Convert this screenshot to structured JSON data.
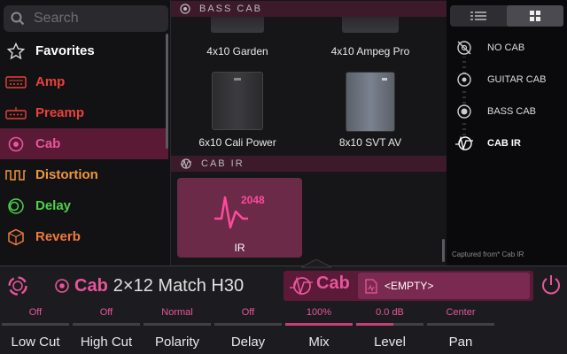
{
  "search": {
    "placeholder": "Search"
  },
  "categories": [
    {
      "label": "Favorites",
      "color": "#ffffff"
    },
    {
      "label": "Amp",
      "color": "#e8433a"
    },
    {
      "label": "Preamp",
      "color": "#e8433a"
    },
    {
      "label": "Cab",
      "color": "#e8559a",
      "selected": true
    },
    {
      "label": "Distortion",
      "color": "#f0963a"
    },
    {
      "label": "Delay",
      "color": "#4fd24a"
    },
    {
      "label": "Reverb",
      "color": "#f07a3a"
    }
  ],
  "browser": {
    "section1": "BASS CAB",
    "items": [
      {
        "label": "4x10 Garden"
      },
      {
        "label": "4x10 Ampeg Pro"
      },
      {
        "label": "6x10 Cali Power"
      },
      {
        "label": "8x10 SVT AV"
      }
    ],
    "section2": "CAB IR",
    "ir": {
      "label": "IR",
      "size": "2048"
    }
  },
  "right_panel": {
    "options": [
      {
        "label": "NO CAB",
        "icon": "no-cab-icon"
      },
      {
        "label": "GUITAR CAB",
        "icon": "guitar-cab-icon"
      },
      {
        "label": "BASS CAB",
        "icon": "bass-cab-icon"
      },
      {
        "label": "CAB IR",
        "icon": "cab-ir-icon",
        "selected": true
      }
    ],
    "captured_note": "Captured from* Cab IR"
  },
  "bottom": {
    "category": "Cab",
    "model": "2×12 Match H30",
    "cab_type": "Cab",
    "ir_value": "<EMPTY>"
  },
  "params": [
    {
      "name": "Low Cut",
      "value": "Off",
      "fill": 0.0
    },
    {
      "name": "High Cut",
      "value": "Off",
      "fill": 0.0
    },
    {
      "name": "Polarity",
      "value": "Normal",
      "fill": 0.0
    },
    {
      "name": "Delay",
      "value": "Off",
      "fill": 0.0
    },
    {
      "name": "Mix",
      "value": "100%",
      "fill": 1.0
    },
    {
      "name": "Level",
      "value": "0.0 dB",
      "fill": 0.55
    },
    {
      "name": "Pan",
      "value": "Center",
      "fill": 0.0
    }
  ],
  "colors": {
    "accent": "#e8559a",
    "accent_dark": "#5a1a38"
  }
}
